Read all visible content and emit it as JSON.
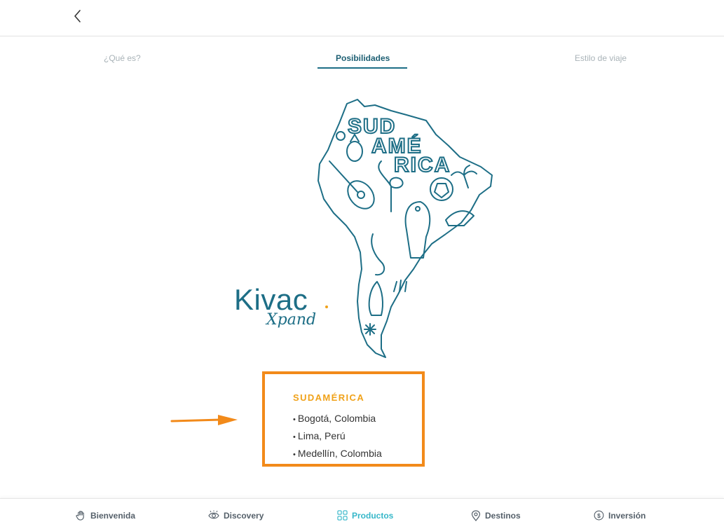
{
  "header": {
    "back_icon": "chevron-left-icon"
  },
  "tabs": [
    {
      "label": "¿Qué es?",
      "active": false
    },
    {
      "label": "Posibilidades",
      "active": true
    },
    {
      "label": "Estilo de viaje",
      "active": false
    }
  ],
  "map": {
    "text_lines": [
      "SUD",
      "AMÉ",
      "RICA"
    ],
    "color": "#1d6e86"
  },
  "logo": {
    "main": "Kivac",
    "sub": "Xpand"
  },
  "info": {
    "title": "SUDAMÉRICA",
    "items": [
      "Bogotá, Colombia",
      "Lima, Perú",
      "Medellín, Colombia"
    ],
    "border_color": "#f28a1a",
    "title_color": "#f0a21a"
  },
  "bottom_nav": [
    {
      "label": "Bienvenida",
      "icon": "hand-wave-icon",
      "active": false
    },
    {
      "label": "Discovery",
      "icon": "eye-icon",
      "active": false
    },
    {
      "label": "Productos",
      "icon": "grid-icon",
      "active": true
    },
    {
      "label": "Destinos",
      "icon": "location-pin-icon",
      "active": false
    },
    {
      "label": "Inversión",
      "icon": "dollar-coin-icon",
      "active": false
    }
  ],
  "colors": {
    "accent": "#36b7c9",
    "brand": "#1d6e86",
    "highlight": "#f28a1a"
  }
}
